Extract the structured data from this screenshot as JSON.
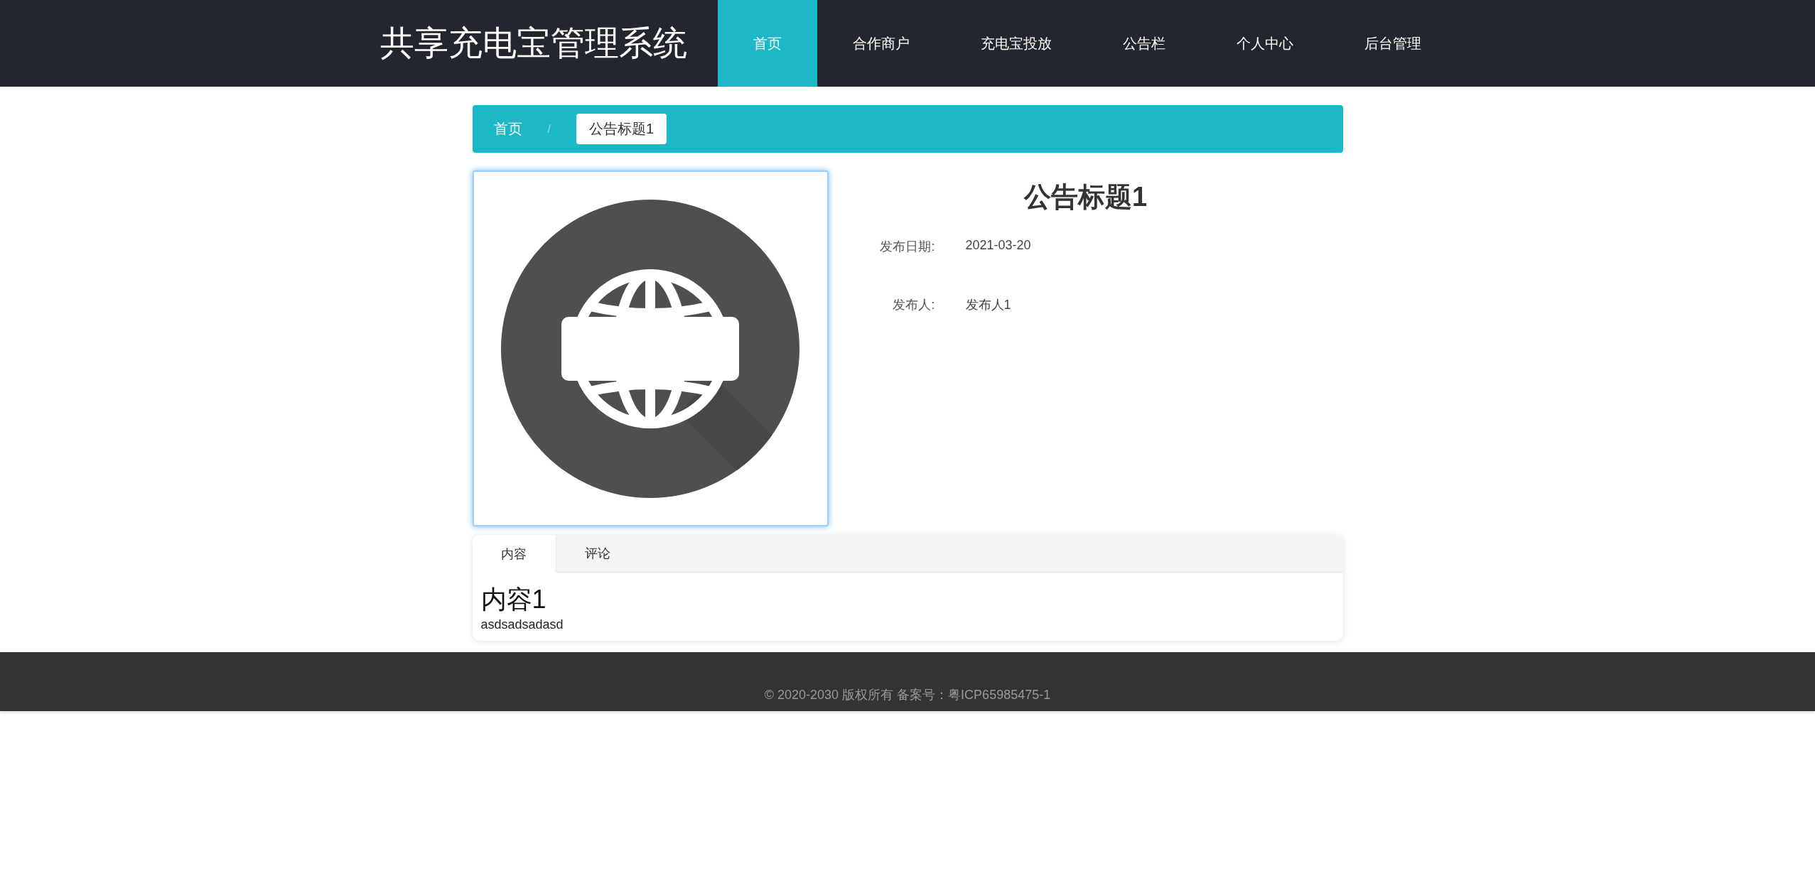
{
  "header": {
    "logo": "共享充电宝管理系统",
    "nav": [
      {
        "label": "首页",
        "selected": true
      },
      {
        "label": "合作商户",
        "selected": false
      },
      {
        "label": "充电宝投放",
        "selected": false
      },
      {
        "label": "公告栏",
        "selected": false
      },
      {
        "label": "个人中心",
        "selected": false
      },
      {
        "label": "后台管理",
        "selected": false
      }
    ]
  },
  "breadcrumb": {
    "items": [
      "首页",
      "公告标题1"
    ],
    "separator": "/"
  },
  "notice": {
    "title": "公告标题1",
    "fields": [
      {
        "label": "发布日期:",
        "value": "2021-03-20"
      },
      {
        "label": "发布人:",
        "value": "发布人1"
      }
    ]
  },
  "tabs": [
    {
      "label": "内容",
      "selected": true
    },
    {
      "label": "评论",
      "selected": false
    }
  ],
  "content": {
    "heading": "内容1",
    "body": "asdsadsadasd"
  },
  "footer": {
    "text": "© 2020-2030 版权所有 备案号：粤ICP65985475-1"
  }
}
